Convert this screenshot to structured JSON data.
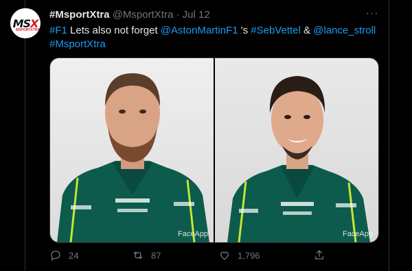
{
  "tweet": {
    "author_name": "#MsportXtra",
    "author_handle": "@MsportXtra",
    "separator": "·",
    "date": "Jul 12",
    "avatar_logo_left": "MS",
    "avatar_logo_x": "X",
    "avatar_logo_sub": "MSPORTXTRA",
    "more_label": "···",
    "text_parts": {
      "tag_f1": "#F1",
      "t1": " Lets also not forget ",
      "mention_team": "@AstonMartinF1",
      "t2": " 's ",
      "tag_driver": "#SebVettel",
      "t3": " & ",
      "mention_driver": "@lance_stroll",
      "tag_brand": "#MsportXtra"
    },
    "media": {
      "left_watermark": "FaceApp",
      "right_watermark": "FaceApp"
    },
    "actions": {
      "replies": "24",
      "retweets": "87",
      "likes": "1,796"
    }
  },
  "colors": {
    "background": "#000000",
    "text": "#e7e9ea",
    "muted": "#71767b",
    "link": "#1d9bf0",
    "suit": "#0d5b4c",
    "suit_accent": "#c8e632"
  }
}
